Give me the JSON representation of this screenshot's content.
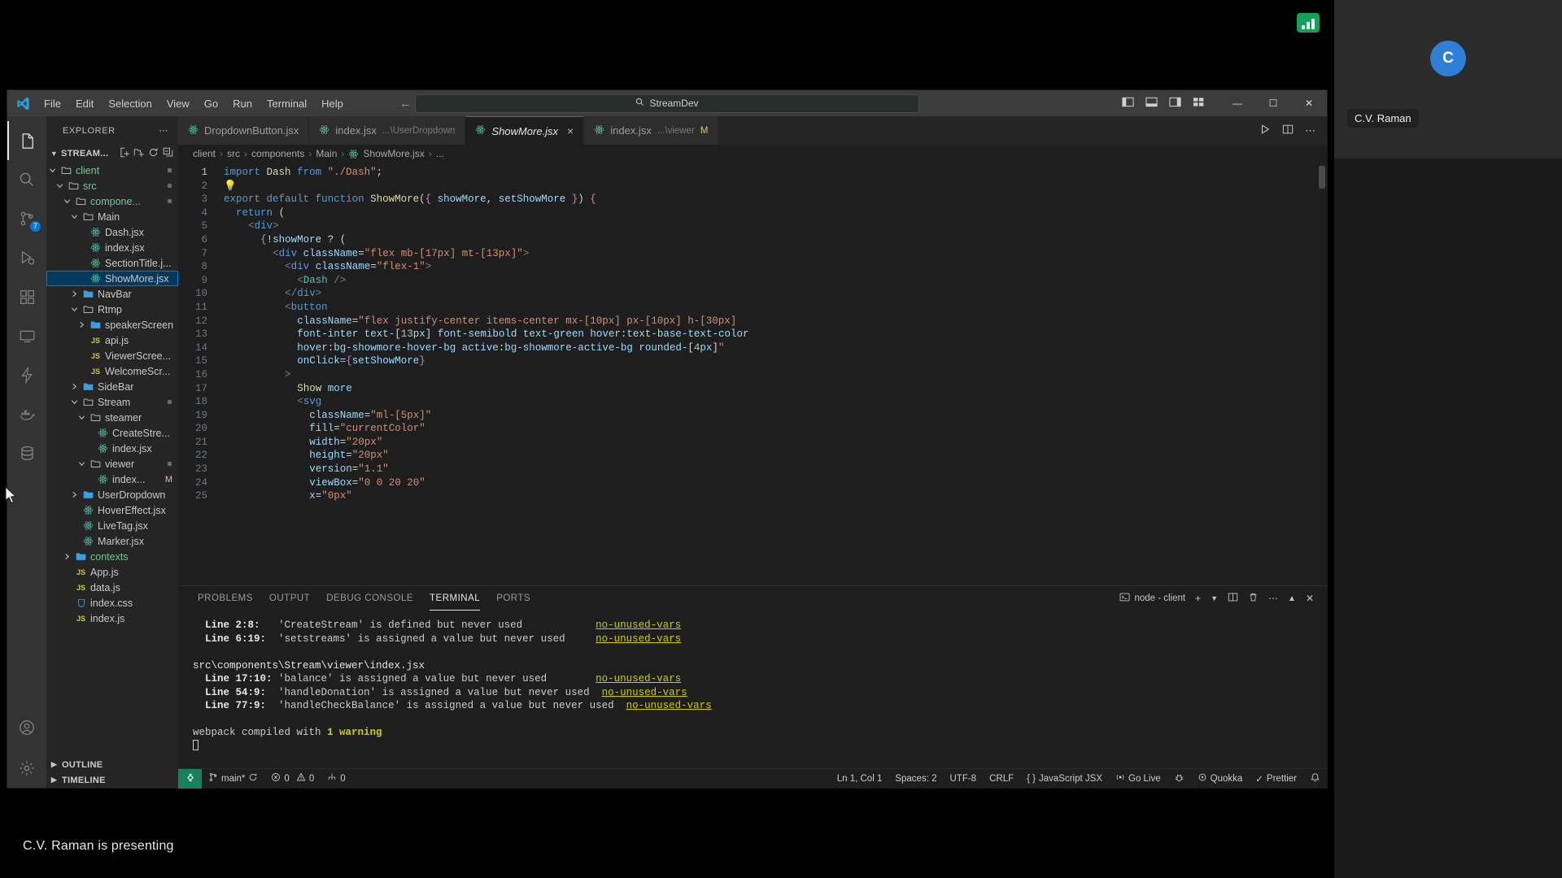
{
  "meeting": {
    "presenting_text": "C.V. Raman is presenting",
    "participant_name": "C.V. Raman",
    "participant_initial": "C",
    "network_icon": "signal-strength-icon"
  },
  "titlebar": {
    "logo_icon": "vscode-logo-icon",
    "menus": [
      "File",
      "Edit",
      "Selection",
      "View",
      "Go",
      "Run",
      "Terminal",
      "Help"
    ],
    "back_icon": "arrow-left-icon",
    "forward_icon": "arrow-right-icon",
    "search_icon": "search-icon",
    "search_value": "StreamDev",
    "layout_icons": [
      "toggle-primary-sidebar-icon",
      "toggle-panel-icon",
      "toggle-secondary-sidebar-icon",
      "customize-layout-icon"
    ],
    "minimize_label": "—",
    "maximize_label": "☐",
    "close_label": "✕"
  },
  "activitybar": {
    "items": [
      {
        "name": "explorer-icon",
        "active": true,
        "badge": ""
      },
      {
        "name": "search-icon",
        "active": false,
        "badge": ""
      },
      {
        "name": "source-control-icon",
        "active": false,
        "badge": "7"
      },
      {
        "name": "run-and-debug-icon",
        "active": false,
        "badge": ""
      },
      {
        "name": "extensions-icon",
        "active": false,
        "badge": ""
      },
      {
        "name": "remote-explorer-icon",
        "active": false,
        "badge": ""
      },
      {
        "name": "thunder-client-icon",
        "active": false,
        "badge": ""
      },
      {
        "name": "docker-icon",
        "active": false,
        "badge": ""
      },
      {
        "name": "database-icon",
        "active": false,
        "badge": ""
      }
    ],
    "bottom": [
      {
        "name": "accounts-icon"
      },
      {
        "name": "settings-gear-icon"
      }
    ]
  },
  "sidebar": {
    "title": "EXPLORER",
    "more_icon": "ellipsis-icon",
    "root_label": "STREAM...",
    "root_actions": [
      "new-file-icon",
      "new-folder-icon",
      "refresh-icon",
      "collapse-all-icon"
    ],
    "tree": [
      {
        "label": "client",
        "depth": 1,
        "kind": "folder",
        "state": "open",
        "badge": "dot"
      },
      {
        "label": "src",
        "depth": 2,
        "kind": "folder",
        "state": "open",
        "badge": "dot"
      },
      {
        "label": "compone...",
        "depth": 3,
        "kind": "folder",
        "state": "open",
        "badge": "dot"
      },
      {
        "label": "Main",
        "depth": 4,
        "kind": "folder",
        "state": "open",
        "badge": ""
      },
      {
        "label": "Dash.jsx",
        "depth": 5,
        "kind": "react",
        "state": "",
        "badge": ""
      },
      {
        "label": "index.jsx",
        "depth": 5,
        "kind": "react",
        "state": "",
        "badge": ""
      },
      {
        "label": "SectionTitle.j...",
        "depth": 5,
        "kind": "react",
        "state": "",
        "badge": ""
      },
      {
        "label": "ShowMore.jsx",
        "depth": 5,
        "kind": "react",
        "state": "selected",
        "badge": ""
      },
      {
        "label": "NavBar",
        "depth": 4,
        "kind": "folder-blue",
        "state": "closed",
        "badge": ""
      },
      {
        "label": "Rtmp",
        "depth": 4,
        "kind": "folder",
        "state": "open",
        "badge": ""
      },
      {
        "label": "speakerScreen",
        "depth": 5,
        "kind": "folder-blue",
        "state": "closed",
        "badge": ""
      },
      {
        "label": "api.js",
        "depth": 5,
        "kind": "js",
        "state": "",
        "badge": ""
      },
      {
        "label": "ViewerScree...",
        "depth": 5,
        "kind": "js",
        "state": "",
        "badge": ""
      },
      {
        "label": "WelcomeScr...",
        "depth": 5,
        "kind": "js",
        "state": "",
        "badge": ""
      },
      {
        "label": "SideBar",
        "depth": 4,
        "kind": "folder-blue",
        "state": "closed",
        "badge": ""
      },
      {
        "label": "Stream",
        "depth": 4,
        "kind": "folder",
        "state": "open",
        "badge": "dot"
      },
      {
        "label": "steamer",
        "depth": 5,
        "kind": "folder",
        "state": "open",
        "badge": ""
      },
      {
        "label": "CreateStre...",
        "depth": 6,
        "kind": "react",
        "state": "",
        "badge": ""
      },
      {
        "label": "index.jsx",
        "depth": 6,
        "kind": "react",
        "state": "",
        "badge": ""
      },
      {
        "label": "viewer",
        "depth": 5,
        "kind": "folder",
        "state": "open",
        "badge": "dot"
      },
      {
        "label": "index...",
        "depth": 6,
        "kind": "react",
        "state": "",
        "badge": "M"
      },
      {
        "label": "UserDropdown",
        "depth": 4,
        "kind": "folder-blue",
        "state": "closed",
        "badge": ""
      },
      {
        "label": "HoverEffect.jsx",
        "depth": 4,
        "kind": "react",
        "state": "",
        "badge": ""
      },
      {
        "label": "LiveTag.jsx",
        "depth": 4,
        "kind": "react",
        "state": "",
        "badge": ""
      },
      {
        "label": "Marker.jsx",
        "depth": 4,
        "kind": "react",
        "state": "",
        "badge": ""
      },
      {
        "label": "contexts",
        "depth": 3,
        "kind": "folder-blue",
        "state": "closed",
        "badge": ""
      },
      {
        "label": "App.js",
        "depth": 3,
        "kind": "js",
        "state": "",
        "badge": ""
      },
      {
        "label": "data.js",
        "depth": 3,
        "kind": "js",
        "state": "",
        "badge": ""
      },
      {
        "label": "index.css",
        "depth": 3,
        "kind": "css",
        "state": "",
        "badge": ""
      },
      {
        "label": "index.js",
        "depth": 3,
        "kind": "js",
        "state": "",
        "badge": ""
      }
    ],
    "footer": [
      {
        "label": "OUTLINE"
      },
      {
        "label": "TIMELINE"
      }
    ]
  },
  "editor": {
    "tabs": [
      {
        "label": "DropdownButton.jsx",
        "sub": "",
        "active": false,
        "modified": false,
        "closable": false
      },
      {
        "label": "index.jsx",
        "sub": "...\\UserDropdown",
        "active": false,
        "modified": false,
        "closable": false
      },
      {
        "label": "ShowMore.jsx",
        "sub": "",
        "active": true,
        "modified": false,
        "closable": true
      },
      {
        "label": "index.jsx",
        "sub": "...\\viewer",
        "active": false,
        "modified": true,
        "closable": false
      }
    ],
    "tab_actions": [
      "run-code-icon",
      "split-editor-icon",
      "more-actions-icon"
    ],
    "breadcrumb": [
      "client",
      "src",
      "components",
      "Main",
      "ShowMore.jsx",
      "..."
    ],
    "breadcrumb_file_icon": "react-file-icon",
    "first_line": 1,
    "last_line": 25,
    "lines": [
      {
        "n": 1,
        "text": "import Dash from \"./Dash\";"
      },
      {
        "n": 2,
        "text": "💡"
      },
      {
        "n": 3,
        "text": "export default function ShowMore({ showMore, setShowMore }) {"
      },
      {
        "n": 4,
        "text": "  return ("
      },
      {
        "n": 5,
        "text": "    <div>"
      },
      {
        "n": 6,
        "text": "      {!showMore ? ("
      },
      {
        "n": 7,
        "text": "        <div className=\"flex mb-[17px] mt-[13px]\">"
      },
      {
        "n": 8,
        "text": "          <div className=\"flex-1\">"
      },
      {
        "n": 9,
        "text": "            <Dash />"
      },
      {
        "n": 10,
        "text": "          </div>"
      },
      {
        "n": 11,
        "text": "          <button"
      },
      {
        "n": 12,
        "text": "            className=\"flex justify-center items-center mx-[10px] px-[10px] h-[30px]"
      },
      {
        "n": 13,
        "text": "            font-inter text-[13px] font-semibold text-green hover:text-base-text-color"
      },
      {
        "n": 14,
        "text": "            hover:bg-showmore-hover-bg active:bg-showmore-active-bg rounded-[4px]\""
      },
      {
        "n": 15,
        "text": "            onClick={setShowMore}"
      },
      {
        "n": 16,
        "text": "          >"
      },
      {
        "n": 17,
        "text": "            Show more"
      },
      {
        "n": 18,
        "text": "            <svg"
      },
      {
        "n": 19,
        "text": "              className=\"ml-[5px]\""
      },
      {
        "n": 20,
        "text": "              fill=\"currentColor\""
      },
      {
        "n": 21,
        "text": "              width=\"20px\""
      },
      {
        "n": 22,
        "text": "              height=\"20px\""
      },
      {
        "n": 23,
        "text": "              version=\"1.1\""
      },
      {
        "n": 24,
        "text": "              viewBox=\"0 0 20 20\""
      },
      {
        "n": 25,
        "text": "              x=\"0px\""
      }
    ]
  },
  "panel": {
    "tabs": [
      "PROBLEMS",
      "OUTPUT",
      "DEBUG CONSOLE",
      "TERMINAL",
      "PORTS"
    ],
    "active_tab": "TERMINAL",
    "shell_icon": "terminal-icon",
    "shell_label": "node - client",
    "actions": [
      "new-terminal-icon",
      "chevron-down-icon",
      "split-terminal-icon",
      "kill-terminal-icon",
      "more-actions-icon",
      "maximize-panel-icon",
      "close-panel-icon"
    ],
    "terminal_lines": [
      {
        "kind": "warn",
        "label": "Line 2:8:",
        "msg": "'CreateStream' is defined but never used",
        "rule": "no-unused-vars"
      },
      {
        "kind": "warn",
        "label": "Line 6:19:",
        "msg": "'setstreams' is assigned a value but never used",
        "rule": "no-unused-vars"
      },
      {
        "kind": "blank"
      },
      {
        "kind": "path",
        "label": "src\\components\\Stream\\viewer\\index.jsx"
      },
      {
        "kind": "warn",
        "label": "Line 17:10:",
        "msg": "'balance' is assigned a value but never used",
        "rule": "no-unused-vars"
      },
      {
        "kind": "warn",
        "label": "Line 54:9:",
        "msg": "'handleDonation' is assigned a value but never used",
        "rule": "no-unused-vars"
      },
      {
        "kind": "warn",
        "label": "Line 77:9:",
        "msg": "'handleCheckBalance' is assigned a value but never used",
        "rule": "no-unused-vars"
      },
      {
        "kind": "blank"
      },
      {
        "kind": "compiled",
        "pre": "webpack compiled with ",
        "count": "1 warning"
      },
      {
        "kind": "prompt"
      }
    ]
  },
  "statusbar": {
    "remote_icon": "remote-window-icon",
    "branch_icon": "source-control-branch-icon",
    "branch": "main*",
    "sync_icon": "sync-icon",
    "errors_icon": "error-icon",
    "errors": "0",
    "warnings_icon": "warning-icon",
    "warnings": "0",
    "ports_icon": "ports-icon",
    "ports": "0",
    "cursor_position": "Ln 1, Col 1",
    "indentation": "Spaces: 2",
    "encoding": "UTF-8",
    "eol": "CRLF",
    "language_icon": "braces-icon",
    "language": "JavaScript JSX",
    "golive_icon": "broadcast-icon",
    "golive": "Go Live",
    "bug_icon": "bug-icon",
    "quokka_icon": "quokka-icon",
    "quokka": "Quokka",
    "prettier_icon": "check-icon",
    "prettier": "Prettier",
    "bell_icon": "bell-icon"
  },
  "colors": {
    "accent": "#0078d4",
    "remote_green": "#16825d",
    "warning_yellow": "#cdcd00",
    "modified_orange": "#e2c08d",
    "react_cyan": "#4ec9b0",
    "js_yellow": "#cbcb41",
    "folder_green": "#73c991"
  }
}
